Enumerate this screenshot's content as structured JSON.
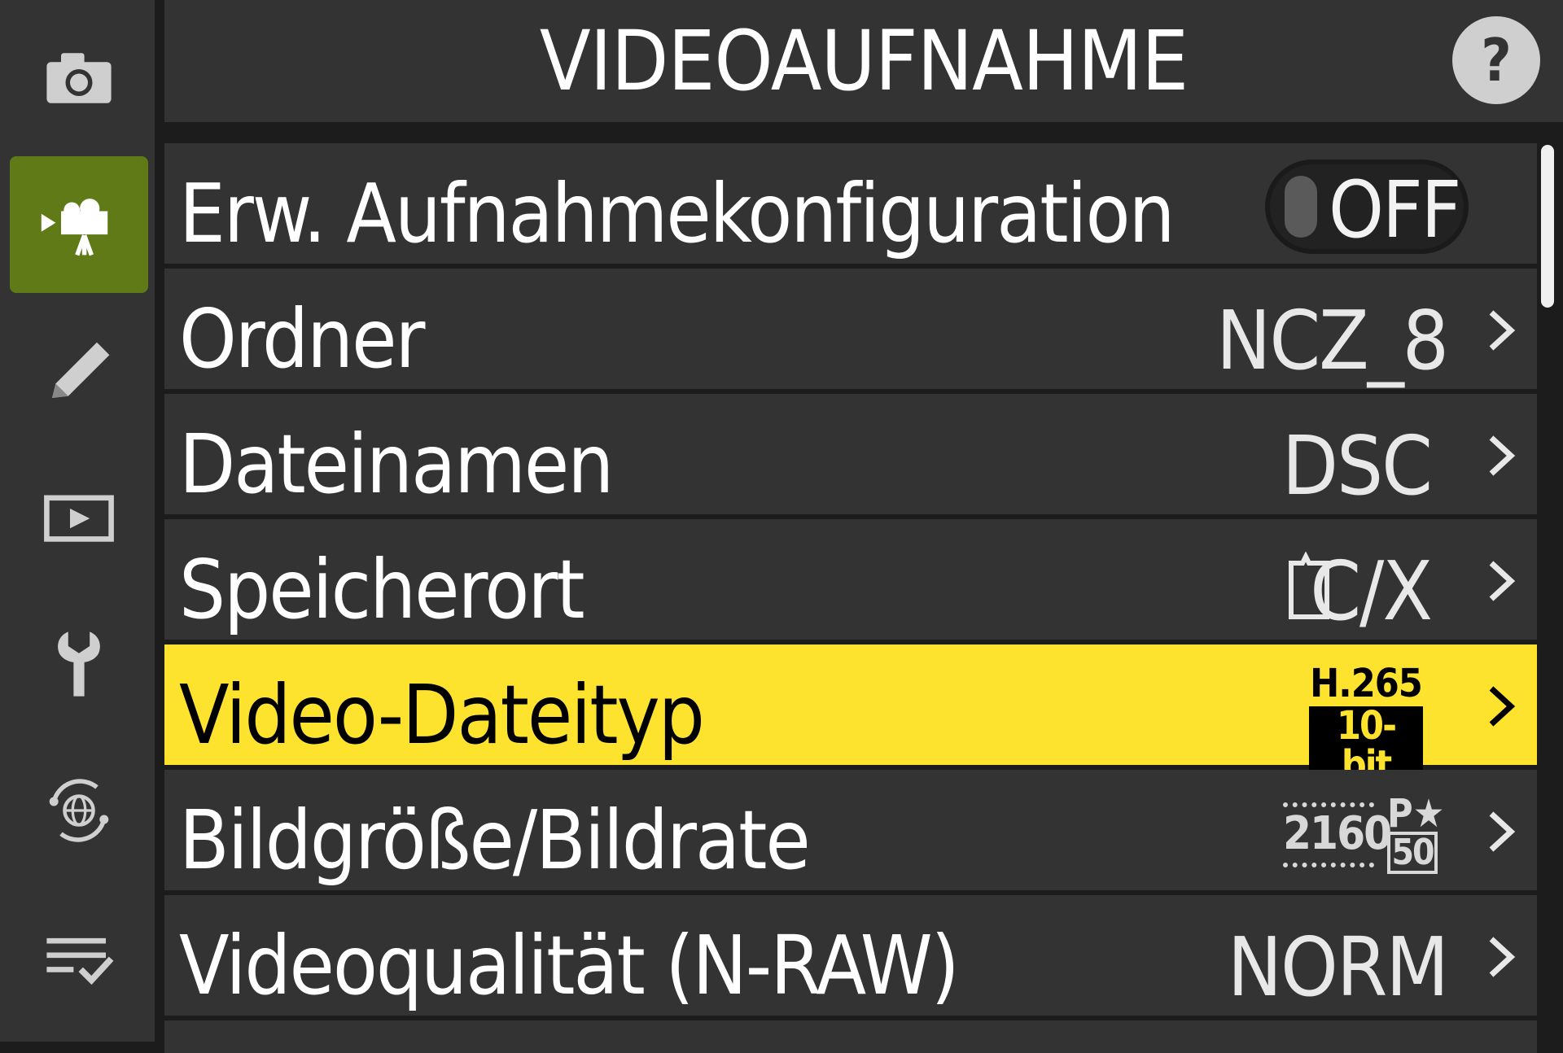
{
  "header": {
    "title": "VIDEOAUFNAHME",
    "help_label": "?"
  },
  "sidebar": {
    "items": [
      {
        "icon": "camera-icon",
        "active": false
      },
      {
        "icon": "video-camera-icon",
        "active": true
      },
      {
        "icon": "pencil-icon",
        "active": false
      },
      {
        "icon": "playback-icon",
        "active": false
      },
      {
        "icon": "wrench-icon",
        "active": false
      },
      {
        "icon": "network-icon",
        "active": false
      },
      {
        "icon": "my-menu-icon",
        "active": false
      }
    ]
  },
  "menu": {
    "items": [
      {
        "label": "Erw. Aufnahmekonfiguration",
        "value": "OFF"
      },
      {
        "label": "Ordner",
        "value": "NCZ_8"
      },
      {
        "label": "Dateinamen",
        "value": "DSC"
      },
      {
        "label": "Speicherort",
        "value": "C/X"
      },
      {
        "label": "Video-Dateityp",
        "value_top": "H.265",
        "value_bottom": "10-bit"
      },
      {
        "label": "Bildgröße/Bildrate",
        "value_size": "2160",
        "value_mark": "P★",
        "value_rate": "50"
      },
      {
        "label": "Videoqualität (N-RAW)",
        "value": "NORM"
      }
    ],
    "selected_index": 4
  },
  "colors": {
    "selected_row": "#fde22e",
    "active_tab": "#5f7a17",
    "row_bg": "#333333"
  }
}
